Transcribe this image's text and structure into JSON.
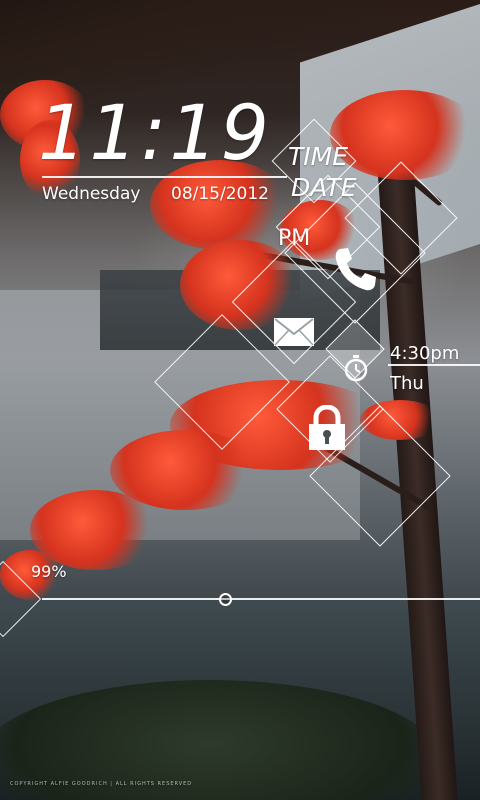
{
  "clock": {
    "time": "11:19",
    "day": "Wednesday",
    "date": "08/15/2012",
    "ampm": "PM"
  },
  "labels": {
    "time": "TIME",
    "date": "DATE"
  },
  "alarm": {
    "time": "4:30pm",
    "day": "Thu"
  },
  "battery": {
    "level": "99%",
    "fraction": 0.99
  },
  "footer": {
    "copyright": "COPYRIGHT ALFIE GOODRICH | ALL RIGHTS RESERVED"
  },
  "icons": [
    "phone-icon",
    "mail-icon",
    "stopwatch-icon",
    "lock-icon"
  ]
}
